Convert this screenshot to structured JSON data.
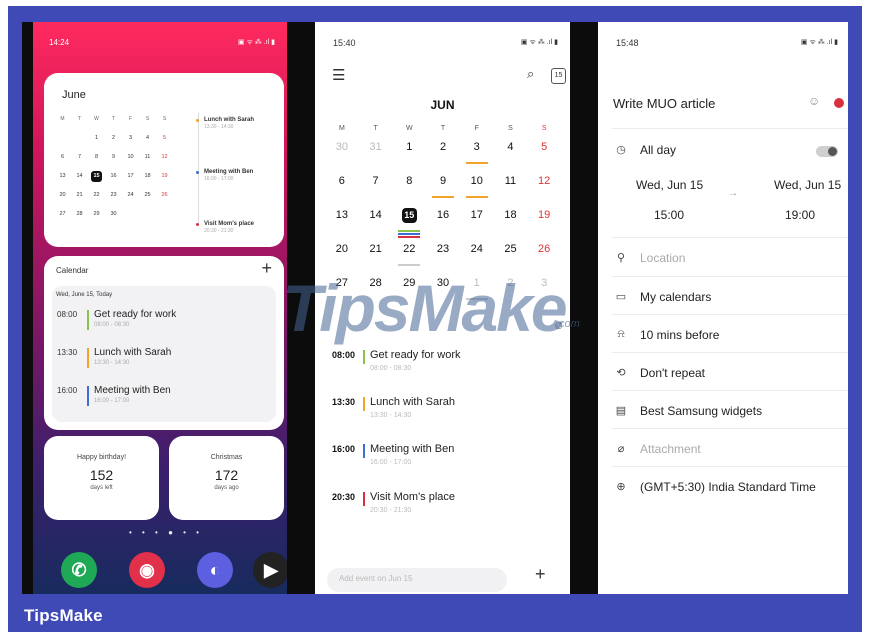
{
  "footer": {
    "brand": "TipsMake"
  },
  "watermark": {
    "text": "TipsMake",
    "suffix": ".com"
  },
  "home": {
    "time": "14:24",
    "status_icons": "▣ ᯤ ⁂ .ıl ▮",
    "month_widget": {
      "month": "June",
      "weekdays": [
        "M",
        "T",
        "W",
        "T",
        "F",
        "S",
        "S"
      ],
      "weeks": [
        [
          "",
          "",
          "1",
          "2",
          "3",
          "4",
          "5"
        ],
        [
          "6",
          "7",
          "8",
          "9",
          "10",
          "11",
          "12"
        ],
        [
          "13",
          "14",
          "15",
          "16",
          "17",
          "18",
          "19"
        ],
        [
          "20",
          "21",
          "22",
          "23",
          "24",
          "25",
          "26"
        ],
        [
          "27",
          "28",
          "29",
          "30",
          "",
          "",
          ""
        ]
      ],
      "events": [
        {
          "title": "Lunch with Sarah",
          "time": "13:30 - 14:30",
          "color": "#f2a32b"
        },
        {
          "title": "Meeting with Ben",
          "time": "16:00 - 17:00",
          "color": "#3d6ed8"
        },
        {
          "title": "Visit Mom's place",
          "time": "20:30 - 21:30",
          "color": "#d93040"
        }
      ]
    },
    "calendar_widget": {
      "title": "Calendar",
      "plus": "+",
      "date": "Wed, June 15, Today",
      "items": [
        {
          "time": "08:00",
          "title": "Get ready for work",
          "range": "08:00 - 08:30",
          "color": "#8bc34a"
        },
        {
          "time": "13:30",
          "title": "Lunch with Sarah",
          "range": "13:30 - 14:30",
          "color": "#f2a32b"
        },
        {
          "time": "16:00",
          "title": "Meeting with Ben",
          "range": "16:00 - 17:00",
          "color": "#3d6ed8"
        }
      ]
    },
    "countdowns": [
      {
        "label": "Happy birthday!",
        "value": "152",
        "unit": "days left"
      },
      {
        "label": "Christmas",
        "value": "172",
        "unit": "days ago"
      }
    ],
    "page_dots": "• • • ● • •",
    "apps": [
      {
        "name": "phone-app-icon",
        "glyph": "✆",
        "color": "#1fa855"
      },
      {
        "name": "camera-app-icon",
        "glyph": "◉",
        "color": "#e0304a"
      },
      {
        "name": "internet-app-icon",
        "glyph": "◐",
        "color": "#5b5fe0"
      },
      {
        "name": "youtube-app-icon",
        "glyph": "▶",
        "color": "#222222"
      }
    ]
  },
  "calendar": {
    "time": "15:40",
    "status_icons": "▣ ᯤ ⁂ .ıl ▮",
    "today_badge": "15",
    "month": "JUN",
    "weekdays": [
      "M",
      "T",
      "W",
      "T",
      "F",
      "S",
      "S"
    ],
    "weeks": [
      [
        "30",
        "31",
        "1",
        "2",
        "3",
        "4",
        "5"
      ],
      [
        "6",
        "7",
        "8",
        "9",
        "10",
        "11",
        "12"
      ],
      [
        "13",
        "14",
        "15",
        "16",
        "17",
        "18",
        "19"
      ],
      [
        "20",
        "21",
        "22",
        "23",
        "24",
        "25",
        "26"
      ],
      [
        "27",
        "28",
        "29",
        "30",
        "1",
        "2",
        "3"
      ]
    ],
    "items": [
      {
        "time": "08:00",
        "title": "Get ready for work",
        "range": "08:00 - 08:30",
        "color": "#8bc34a"
      },
      {
        "time": "13:30",
        "title": "Lunch with Sarah",
        "range": "13:30 - 14:30",
        "color": "#f2a32b"
      },
      {
        "time": "16:00",
        "title": "Meeting with Ben",
        "range": "16:00 - 17:00",
        "color": "#3d6ed8"
      },
      {
        "time": "20:30",
        "title": "Visit Mom's place",
        "range": "20:30 - 21:30",
        "color": "#d93040"
      }
    ],
    "add_placeholder": "Add event on Jun 15",
    "add_plus": "+"
  },
  "event": {
    "time": "15:48",
    "status_icons": "▣ ᯤ ⁂ .ıl ▮",
    "title": "Write MUO article",
    "color": "#d93040",
    "all_day": "All day",
    "start_date": "Wed, Jun 15",
    "start_time": "15:00",
    "end_date": "Wed, Jun 15",
    "end_time": "19:00",
    "arrow": "→",
    "location": "Location",
    "calendar": "My calendars",
    "reminder": "10 mins before",
    "repeat": "Don't repeat",
    "note": "Best Samsung widgets",
    "attachment": "Attachment",
    "timezone": "(GMT+5:30) India Standard Time"
  }
}
